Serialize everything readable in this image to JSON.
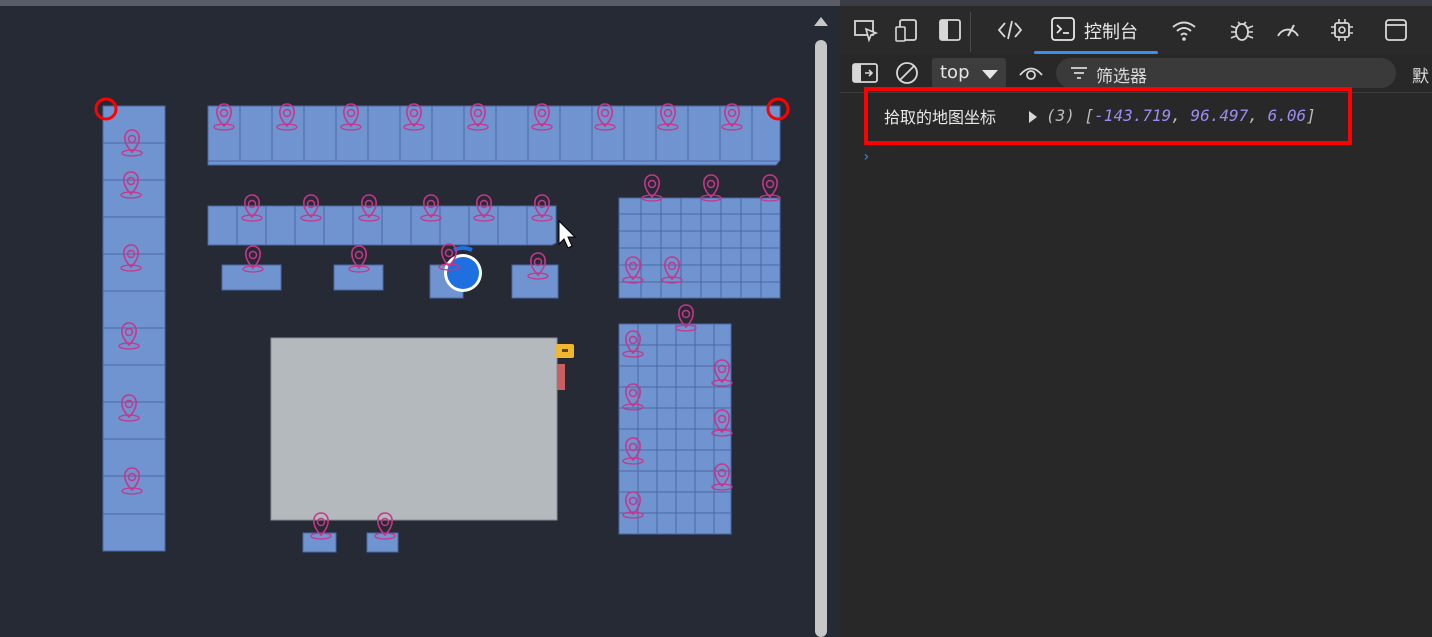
{
  "devtools": {
    "tabs": {
      "console_label": "控制台"
    },
    "filterbar": {
      "context": "top",
      "filter_placeholder": "筛选器",
      "overflow_label": "默"
    },
    "console": {
      "log_label": "拾取的地图坐标",
      "array_count": "(3)",
      "values": [
        "-143.719",
        "96.497",
        "6.06"
      ]
    }
  },
  "colors": {
    "block_fill": "#7094cf",
    "block_stroke": "#4a68a6",
    "marker": "#c8358a",
    "highlight": "#ff0000",
    "console_number": "#9d8cf3"
  },
  "icons": {
    "map_marker": "map-pin-icon",
    "user_location": "location-dot-icon"
  }
}
